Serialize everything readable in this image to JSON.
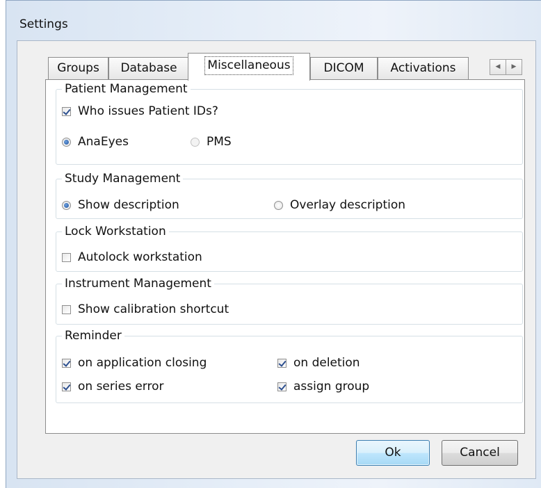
{
  "window": {
    "title": "Settings"
  },
  "tabs": [
    {
      "label": "Groups",
      "selected": false
    },
    {
      "label": "Database",
      "selected": false
    },
    {
      "label": "Miscellaneous",
      "selected": true
    },
    {
      "label": "DICOM",
      "selected": false
    },
    {
      "label": "Activations",
      "selected": false
    }
  ],
  "tab_scroll": {
    "left_icon": "arrow-left-icon",
    "right_icon": "arrow-right-icon"
  },
  "patient_management": {
    "title": "Patient Management",
    "who_issues": {
      "label": "Who issues Patient IDs?",
      "checked": true
    },
    "anaeyes": {
      "label": "AnaEyes",
      "selected": true
    },
    "pms": {
      "label": "PMS",
      "selected": false,
      "disabled": true
    }
  },
  "study_management": {
    "title": "Study Management",
    "show_description": {
      "label": "Show description",
      "selected": true
    },
    "overlay_description": {
      "label": "Overlay description",
      "selected": false
    }
  },
  "lock_workstation": {
    "title": "Lock Workstation",
    "autolock": {
      "label": "Autolock workstation",
      "checked": false
    }
  },
  "instrument_management": {
    "title": "Instrument Management",
    "show_calibration": {
      "label": "Show calibration shortcut",
      "checked": false
    }
  },
  "reminder": {
    "title": "Reminder",
    "on_app_closing": {
      "label": "on application closing",
      "checked": true
    },
    "on_deletion": {
      "label": "on deletion",
      "checked": true
    },
    "on_series_error": {
      "label": "on series error",
      "checked": true
    },
    "assign_group": {
      "label": "assign group",
      "checked": true
    }
  },
  "buttons": {
    "ok": "Ok",
    "cancel": "Cancel"
  },
  "colors": {
    "accent": "#3c7fb1",
    "title_glass": "#d8e4f2",
    "dialog_bg": "#f0f0f0"
  }
}
